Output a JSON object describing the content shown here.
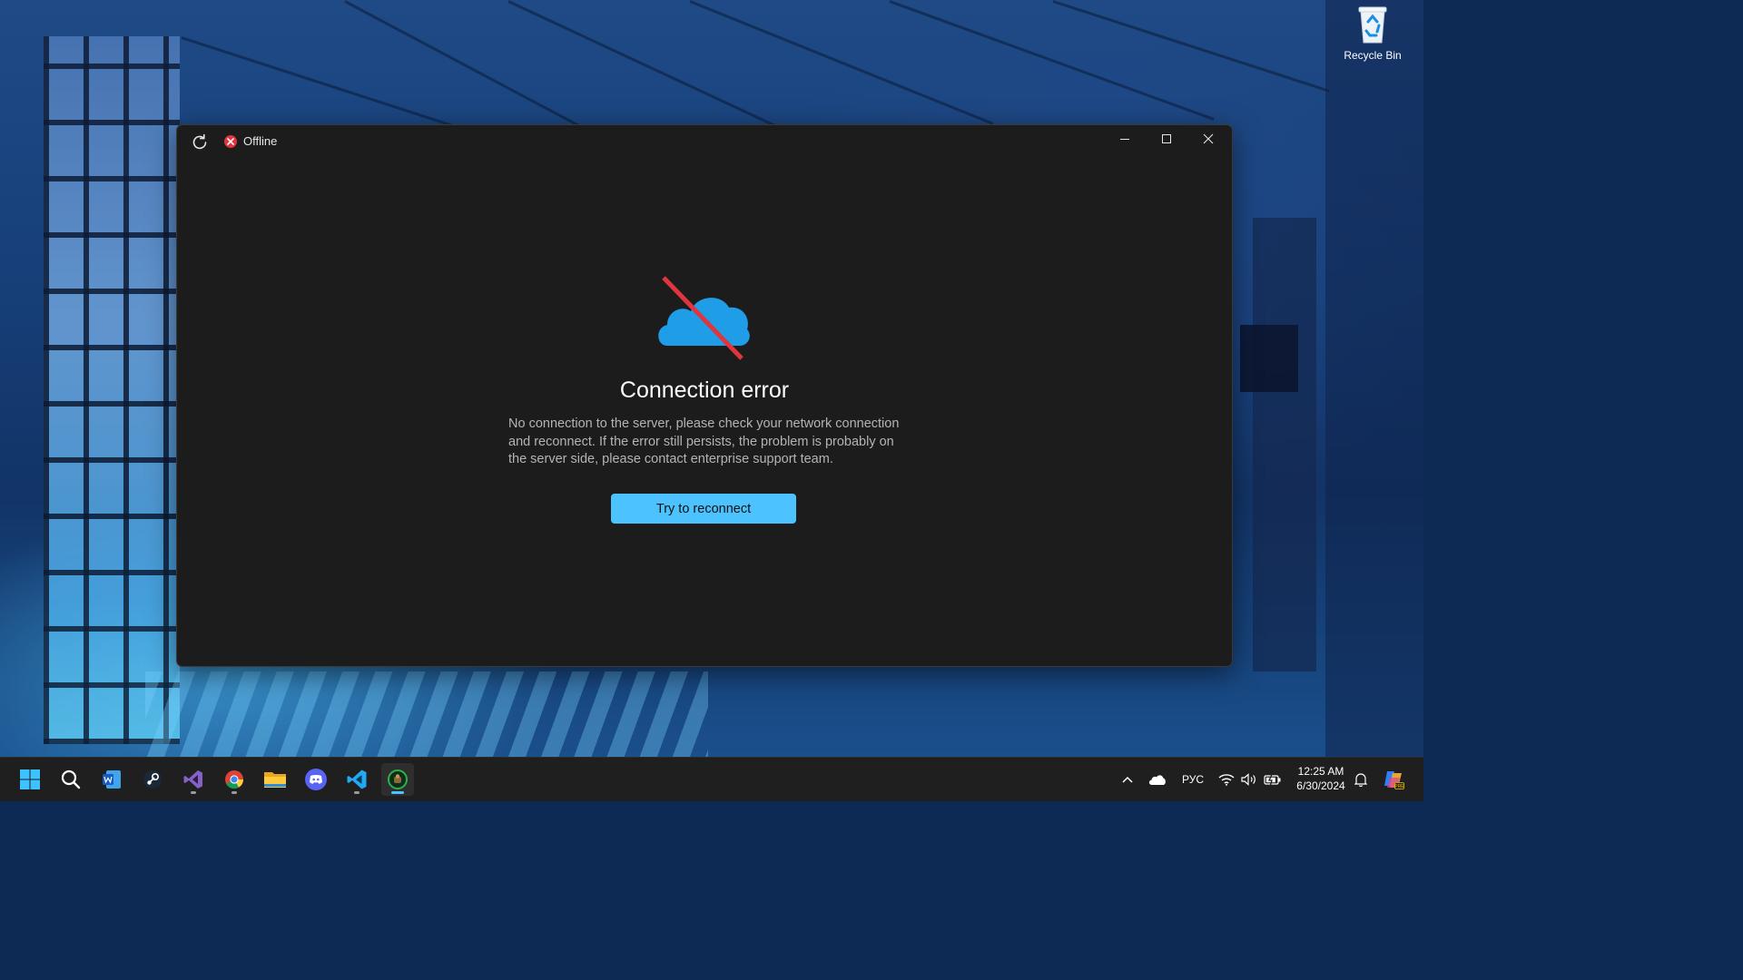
{
  "desktop": {
    "recycle_bin_label": "Recycle Bin"
  },
  "window": {
    "status": "Offline",
    "status_color": "#e0353f",
    "error_title": "Connection error",
    "error_message": "No connection to the server, please check your network connection and reconnect. If the error still persists, the problem is probably on the server side, please contact enterprise support team.",
    "reconnect_label": "Try to reconnect",
    "accent_color": "#4cc2ff",
    "cloud_color": "#1f9de6",
    "slash_color": "#e0353f"
  },
  "taskbar": {
    "apps": [
      "start-icon",
      "search-icon",
      "word-icon",
      "steam-icon",
      "visual-studio-icon",
      "chrome-icon",
      "file-explorer-icon",
      "discord-icon",
      "vscode-icon",
      "app-icon"
    ],
    "language": "РУС",
    "time": "12:25 AM",
    "date": "6/30/2024"
  }
}
